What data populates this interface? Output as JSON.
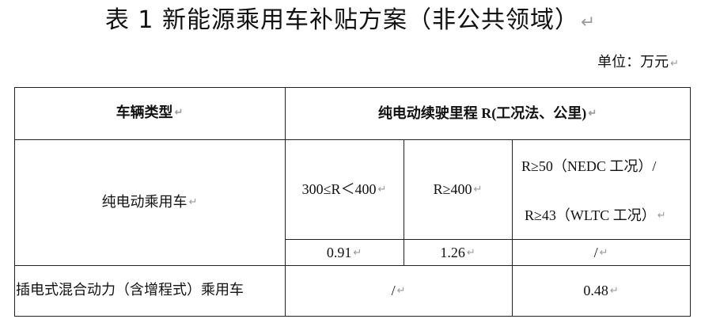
{
  "title": "表 1  新能源乘用车补贴方案（非公共领域）",
  "unit": "单位：万元",
  "para_mark": "↵",
  "table": {
    "header_type": "车辆类型",
    "header_range": "纯电动续驶里程 R(工况法、公里)",
    "bev_label": "纯电动乘用车",
    "range_cols": [
      "300≤R＜400",
      "R≥400"
    ],
    "range_col3_lines": [
      "R≥50（NEDC 工况）/",
      "R≥43（WLTC 工况）"
    ],
    "bev_values": [
      "0.91",
      "1.26",
      "/"
    ],
    "phev_label": "插电式混合动力（含增程式）乘用车",
    "phev_values": [
      "/",
      "0.48"
    ]
  }
}
